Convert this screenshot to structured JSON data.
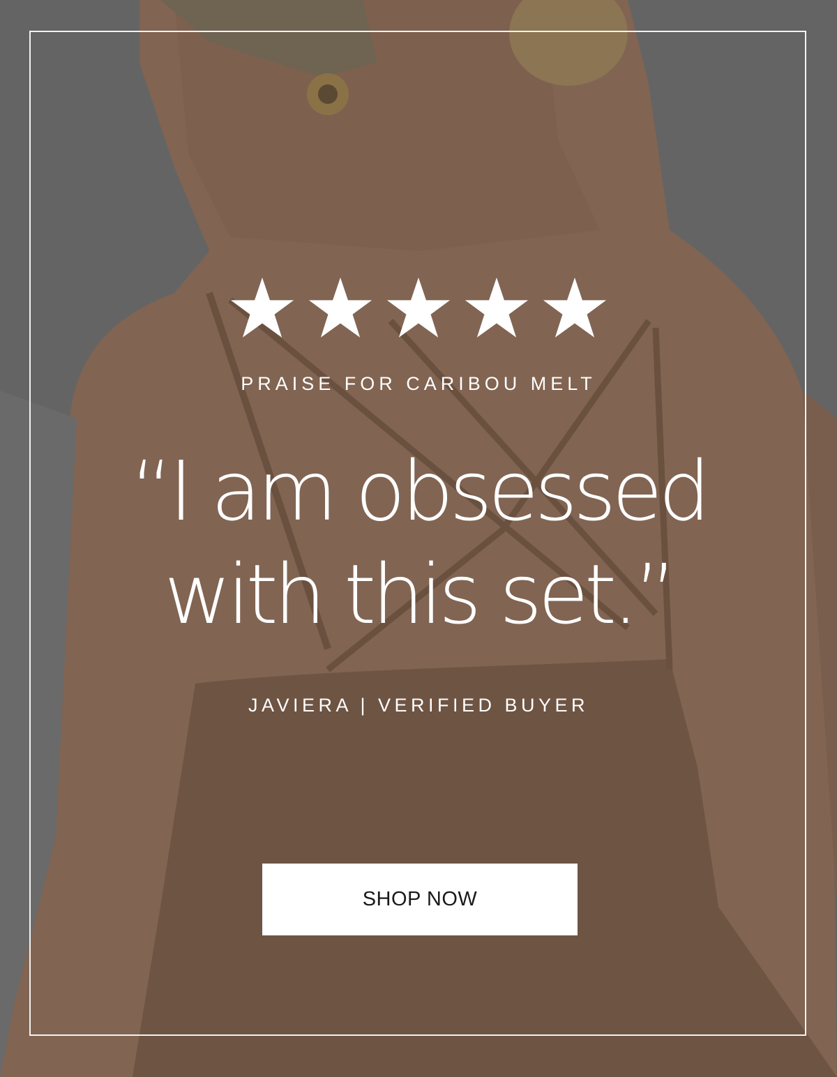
{
  "rating": {
    "value": 5,
    "max": 5,
    "star_color": "#ffffff"
  },
  "review": {
    "eyebrow": "PRAISE FOR CARIBOU MELT",
    "quote_line_1": "“I am obsessed",
    "quote_line_2": "with this set.”",
    "attribution": "JAVIERA | VERIFIED BUYER"
  },
  "cta": {
    "label": "SHOP NOW"
  },
  "theme": {
    "overlay_color": "#646464",
    "garment_color": "#7a6352",
    "skin_color": "#8a6a55",
    "frame_color": "#f2f2f2"
  }
}
